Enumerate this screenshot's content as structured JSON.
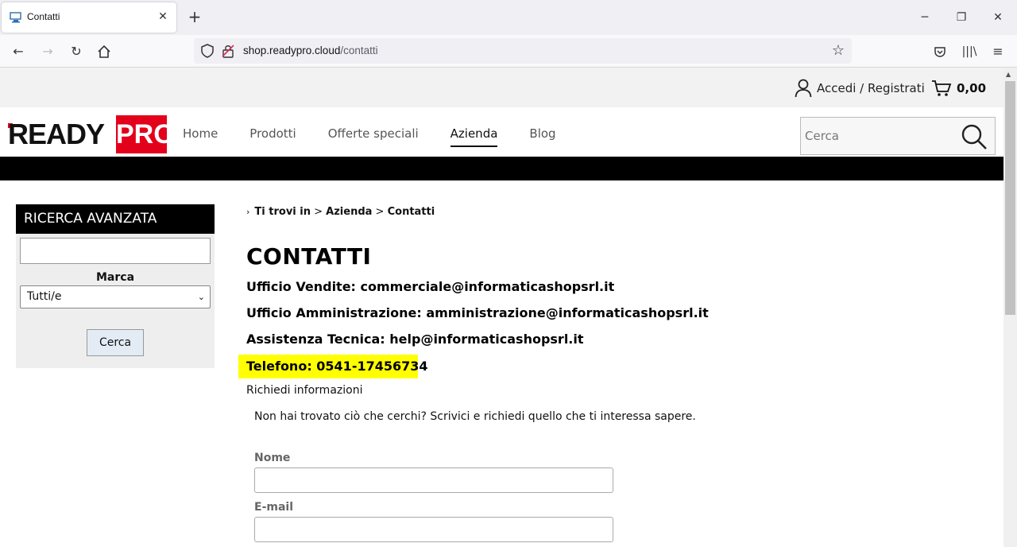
{
  "browser": {
    "tab_title": "Contatti",
    "url_host": "shop.readypro.cloud",
    "url_path": "/contatti"
  },
  "topbar": {
    "account_label": "Accedi / Registrati",
    "cart_total": "0,00"
  },
  "header": {
    "logo_ready": "READY",
    "logo_pro": "PRO",
    "menu": [
      {
        "label": "Home"
      },
      {
        "label": "Prodotti"
      },
      {
        "label": "Offerte speciali"
      },
      {
        "label": "Azienda"
      },
      {
        "label": "Blog"
      }
    ],
    "search_placeholder": "Cerca"
  },
  "sidebar": {
    "title": "RICERCA AVANZATA",
    "brand_label": "Marca",
    "brand_selected": "Tutti/e",
    "search_button": "Cerca"
  },
  "breadcrumb": {
    "prefix": "Ti trovi in",
    "sep": ">",
    "level1": "Azienda",
    "level2": "Contatti"
  },
  "content": {
    "title": "CONTATTI",
    "sales": "Ufficio Vendite: commerciale@informaticashopsrl.it",
    "admin": "Ufficio Amministrazione: amministrazione@informaticashopsrl.it",
    "support": "Assistenza Tecnica: help@informaticashopsrl.it",
    "phone": "Telefono: 0541-17456734",
    "info_title": "Richiedi informazioni",
    "info_desc": "Non hai trovato ciò che cerchi? Scrivici e richiedi quello che ti interessa sapere.",
    "field_name": "Nome",
    "field_email": "E-mail"
  },
  "colors": {
    "brand_red": "#e3001b",
    "highlight": "#ffff00",
    "black": "#000000"
  }
}
